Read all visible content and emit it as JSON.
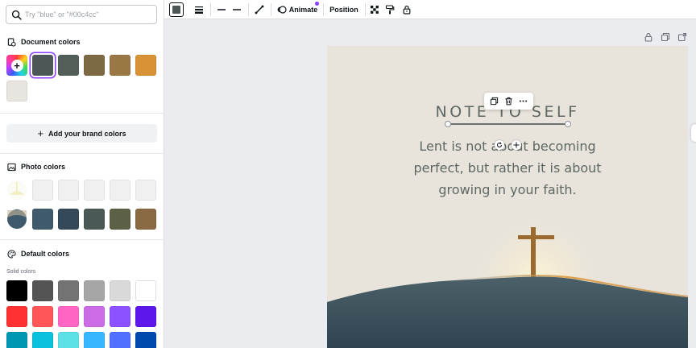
{
  "search": {
    "placeholder": "Try \"blue\" or \"#00c4cc\"",
    "value": ""
  },
  "document_colors": {
    "heading": "Document colors",
    "swatches": [
      "#4e5758",
      "#525f58",
      "#7d6a45",
      "#9a7845",
      "#d99236",
      "#e8e4df"
    ],
    "selected": "#4e5758"
  },
  "brand": {
    "button_label": "Add your brand colors"
  },
  "photo_colors": {
    "heading": "Photo colors",
    "row1": [
      "#f2f2f2",
      "#f0f0f0",
      "#f0f0f0",
      "#f0f0f0",
      "#f0f0f0"
    ],
    "row2": [
      "#3f5a6c",
      "#34495a",
      "#4a5856",
      "#5c6045",
      "#8a6a42"
    ]
  },
  "default_colors": {
    "heading": "Default colors",
    "subheading": "Solid colors",
    "row1": [
      "#000000",
      "#545454",
      "#737373",
      "#a6a6a6",
      "#d9d9d9",
      "#ffffff"
    ],
    "row2": [
      "#ff3131",
      "#ff5757",
      "#ff66c4",
      "#cb6ce6",
      "#8c52ff",
      "#5e17eb"
    ],
    "row3": [
      "#0097b2",
      "#0cc0df",
      "#5ce1e6",
      "#38b6ff",
      "#5170ff",
      "#004aad"
    ]
  },
  "toolbar": {
    "animate_label": "Animate",
    "position_label": "Position",
    "accent": "#8b3dff"
  },
  "design": {
    "title": "NOTE TO SELF",
    "body_line1": "Lent is not about becoming",
    "body_line2": "perfect, but rather it is about",
    "body_line3": "growing in your faith."
  }
}
